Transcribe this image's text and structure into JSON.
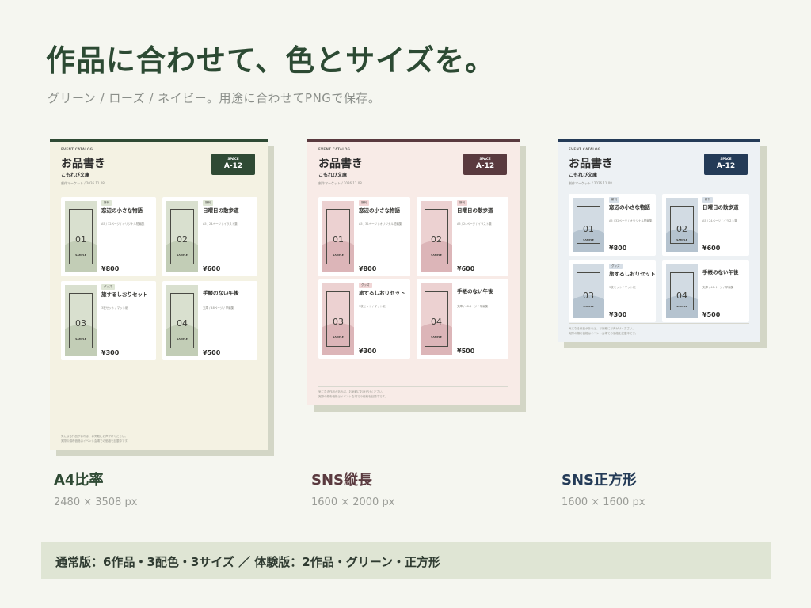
{
  "headline": "作品に合わせて、色とサイズを。",
  "subhead": "グリーン / ローズ / ネイビー。用途に合わせてPNGで保存。",
  "catalog": {
    "eyebrow": "EVENT CATALOG",
    "shop_title": "お品書き",
    "circle_name": "こもれび文庫",
    "event_line": "創作マーケット / 2026.11.08",
    "space_label": "SPACE",
    "space_value": "A-12",
    "sample_label": "SAMPLE",
    "note_line1": "気になる作品があれば、お気軽にお声がけください。",
    "note_line2": "実際の頒布価格はイベント会場での価格を記載中です。",
    "items": [
      {
        "num": "01",
        "tag": "新刊",
        "title": "窓辺の小さな物語",
        "spec": "A5 / 32ページ / オリジナル短編集",
        "price": "¥800"
      },
      {
        "num": "02",
        "tag": "新刊",
        "title": "日曜日の散歩道",
        "spec": "A5 / 24ページ / イラスト集",
        "price": "¥600"
      },
      {
        "num": "03",
        "tag": "グッズ",
        "title": "旅するしおりセット",
        "spec": "3枚セット / マット紙",
        "price": "¥300"
      },
      {
        "num": "04",
        "tag": "",
        "title": "手帳のない午後",
        "spec": "文庫 / 48ページ / 掌編集",
        "price": "¥500"
      }
    ]
  },
  "variants": [
    {
      "name": "A4比率",
      "size": "2480 × 3508 px",
      "theme": "green"
    },
    {
      "name": "SNS縦長",
      "size": "1600 × 2000 px",
      "theme": "rose"
    },
    {
      "name": "SNS正方形",
      "size": "1600 × 1600 px",
      "theme": "navy"
    }
  ],
  "colors": {
    "green": {
      "paper": "#f4f2e3",
      "accent": "#2f4a34",
      "thumb": "#c2cdb6",
      "blob": "#d9e0cf",
      "tag": "#dfe6d6",
      "caption": "#2f4a34"
    },
    "rose": {
      "paper": "#f8ebe7",
      "accent": "#5a3a3f",
      "thumb": "#dcb5b8",
      "blob": "#ecd1d1",
      "tag": "#f1d6d6",
      "caption": "#5a3a3f"
    },
    "navy": {
      "paper": "#edf1f4",
      "accent": "#243b57",
      "thumb": "#b5c3cf",
      "blob": "#d2dbe3",
      "tag": "#d7dfe7",
      "caption": "#243b57"
    }
  },
  "footer": "通常版：6作品・3配色・3サイズ ／ 体験版：2作品・グリーン・正方形"
}
